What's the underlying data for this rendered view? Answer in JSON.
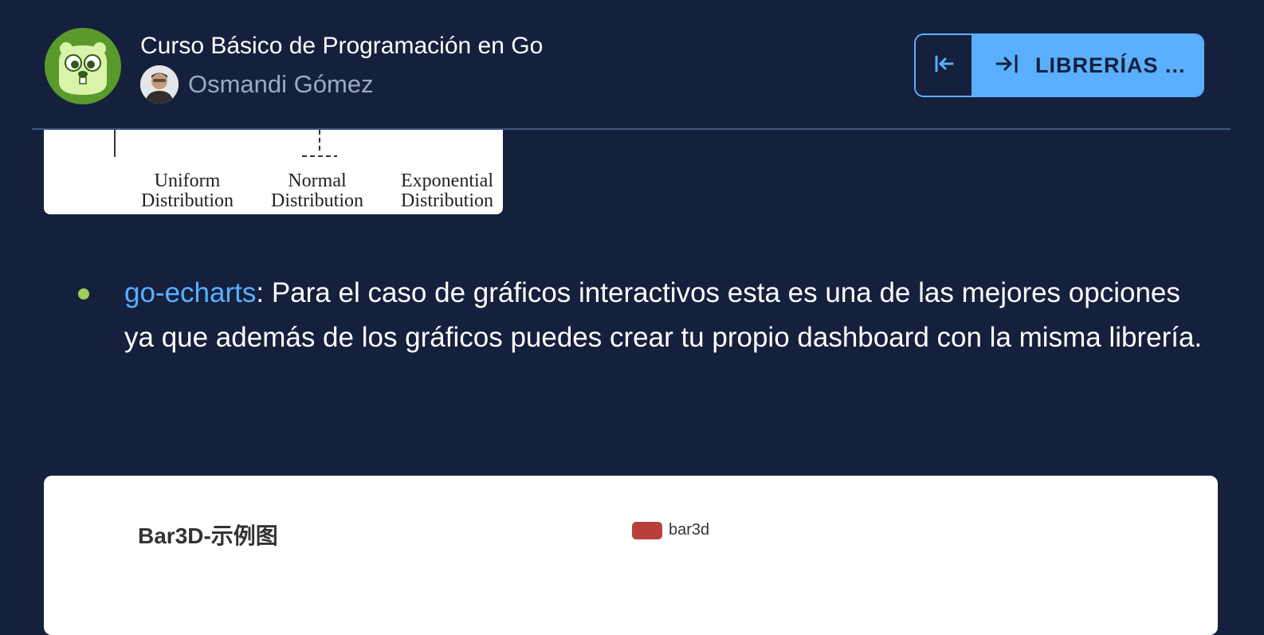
{
  "header": {
    "course_title": "Curso Básico de Programación en Go",
    "author_name": "Osmandi Gómez",
    "next_button_label": "LIBRERÍAS ..."
  },
  "distribution_figure": {
    "labels": [
      "Uniform\nDistribution",
      "Normal\nDistribution",
      "Exponential\nDistribution"
    ]
  },
  "content": {
    "bullet_link": "go-echarts",
    "bullet_text": ": Para el caso de gráficos interactivos esta es una de las mejores opciones ya que además de los gráficos puedes crear tu propio dashboard con la misma librería."
  },
  "chart_data": {
    "type": "bar",
    "title": "Bar3D-示例图",
    "series": [
      {
        "name": "bar3d",
        "color": "#b8403a",
        "values": []
      }
    ]
  },
  "colors": {
    "background": "#15203d",
    "accent": "#5ab0ff",
    "bullet": "#9ccf5a",
    "series": "#b8403a"
  },
  "icons": {
    "logo": "gopher-logo-icon",
    "prev": "arrow-left-to-line-icon",
    "next": "arrow-right-to-line-icon"
  }
}
